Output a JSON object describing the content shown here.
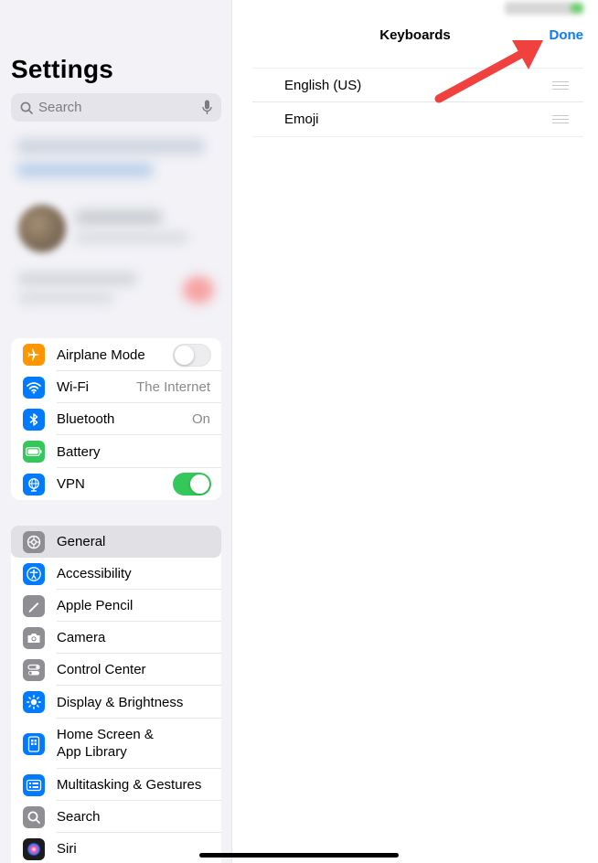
{
  "sidebar": {
    "title": "Settings",
    "search_placeholder": "Search",
    "connectivity": [
      {
        "label": "Airplane Mode",
        "icon": "airplane-icon",
        "color": "#ff9500",
        "toggle": "off"
      },
      {
        "label": "Wi-Fi",
        "icon": "wifi-icon",
        "color": "#007aff",
        "value": "The Internet"
      },
      {
        "label": "Bluetooth",
        "icon": "bluetooth-icon",
        "color": "#007aff",
        "value": "On"
      },
      {
        "label": "Battery",
        "icon": "battery-icon",
        "color": "#34c759"
      },
      {
        "label": "VPN",
        "icon": "globe-icon",
        "color": "#007aff",
        "toggle": "on"
      }
    ],
    "general": [
      {
        "label": "General",
        "icon": "gear-icon",
        "color": "#8e8e93",
        "selected": true
      },
      {
        "label": "Accessibility",
        "icon": "accessibility-icon",
        "color": "#007aff"
      },
      {
        "label": "Apple Pencil",
        "icon": "pencil-icon",
        "color": "#8e8e93"
      },
      {
        "label": "Camera",
        "icon": "camera-icon",
        "color": "#8e8e93"
      },
      {
        "label": "Control Center",
        "icon": "control-center-icon",
        "color": "#8e8e93"
      },
      {
        "label": "Display & Brightness",
        "icon": "sun-icon",
        "color": "#007aff"
      },
      {
        "label": "Home Screen &",
        "label2": "App Library",
        "icon": "home-screen-icon",
        "color": "#007aff"
      },
      {
        "label": "Multitasking & Gestures",
        "icon": "multitasking-icon",
        "color": "#007aff"
      },
      {
        "label": "Search",
        "icon": "search-icon",
        "color": "#8e8e93"
      },
      {
        "label": "Siri",
        "icon": "siri-icon",
        "color": "#1c1c1e"
      }
    ]
  },
  "detail": {
    "title": "Keyboards",
    "done_label": "Done",
    "keyboards": [
      "English (US)",
      "Emoji"
    ]
  },
  "colors": {
    "accent": "#0a7aff",
    "annotation_arrow": "#f0413e",
    "toggle_on": "#34c759"
  }
}
